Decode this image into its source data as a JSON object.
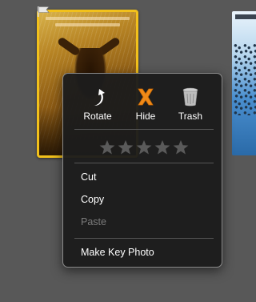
{
  "context_menu": {
    "actions": [
      {
        "label": "Rotate",
        "icon": "rotate-icon"
      },
      {
        "label": "Hide",
        "icon": "hide-x-icon"
      },
      {
        "label": "Trash",
        "icon": "trash-icon"
      }
    ],
    "rating": {
      "stars": 5,
      "value": 0
    },
    "items": [
      {
        "label": "Cut",
        "enabled": true
      },
      {
        "label": "Copy",
        "enabled": true
      },
      {
        "label": "Paste",
        "enabled": false
      },
      {
        "label": "Make Key Photo",
        "enabled": true
      }
    ]
  },
  "photos": [
    {
      "selected": true,
      "flagged": true
    },
    {
      "selected": false
    }
  ],
  "colors": {
    "selection_border": "#f2c11b",
    "hide_icon": "#f08a18",
    "background": "#585858",
    "menu_bg": "#1c1c1c"
  }
}
